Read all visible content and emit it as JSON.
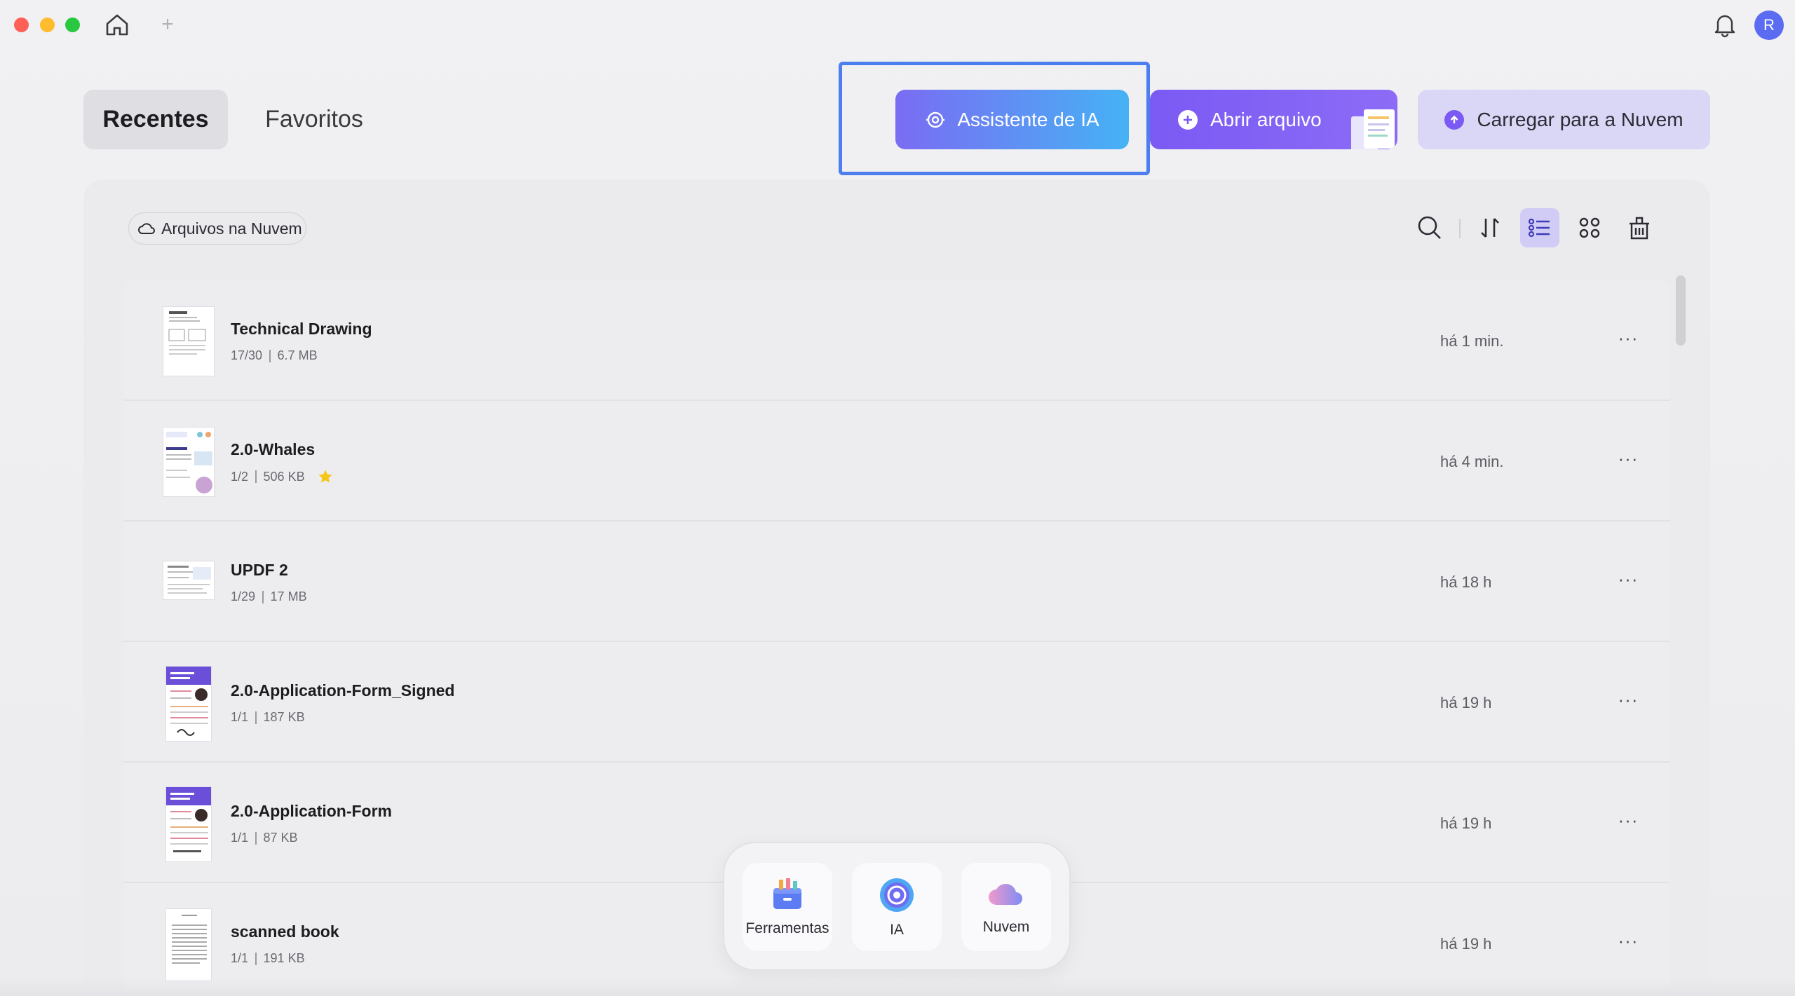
{
  "window": {
    "title_buttons": [
      "close",
      "minimize",
      "maximize"
    ],
    "home_icon": "home-icon",
    "add_tab_label": "+",
    "bell_icon": "bell-icon",
    "avatar_initial": "R"
  },
  "tabs": {
    "recent": "Recentes",
    "favorites": "Favoritos"
  },
  "actions": {
    "ai_assistant": "Assistente de IA",
    "open_file": "Abrir arquivo",
    "upload_cloud": "Carregar para a Nuvem"
  },
  "toolbar": {
    "cloud_files": "Arquivos na Nuvem",
    "icons": [
      "search-icon",
      "sort-icon",
      "list-view-icon",
      "grid-view-icon",
      "trash-icon"
    ],
    "active_view": "list"
  },
  "files": [
    {
      "name": "Technical Drawing",
      "pages": "17/30",
      "size": "6.7 MB",
      "time": "há 1 min.",
      "starred": false
    },
    {
      "name": "2.0-Whales",
      "pages": "1/2",
      "size": "506 KB",
      "time": "há 4 min.",
      "starred": true
    },
    {
      "name": "UPDF 2",
      "pages": "1/29",
      "size": "17 MB",
      "time": "há 18 h",
      "starred": false
    },
    {
      "name": "2.0-Application-Form_Signed",
      "pages": "1/1",
      "size": "187 KB",
      "time": "há 19 h",
      "starred": false
    },
    {
      "name": "2.0-Application-Form",
      "pages": "1/1",
      "size": "87 KB",
      "time": "há 19 h",
      "starred": false
    },
    {
      "name": "scanned book",
      "pages": "1/1",
      "size": "191 KB",
      "time": "há 19 h",
      "starred": false
    }
  ],
  "more_label": "···",
  "dock": {
    "tools": "Ferramentas",
    "ai": "IA",
    "cloud": "Nuvem"
  },
  "colors": {
    "accent": "#7a5af3",
    "highlight": "#4d7ef0",
    "star": "#f5c518"
  }
}
